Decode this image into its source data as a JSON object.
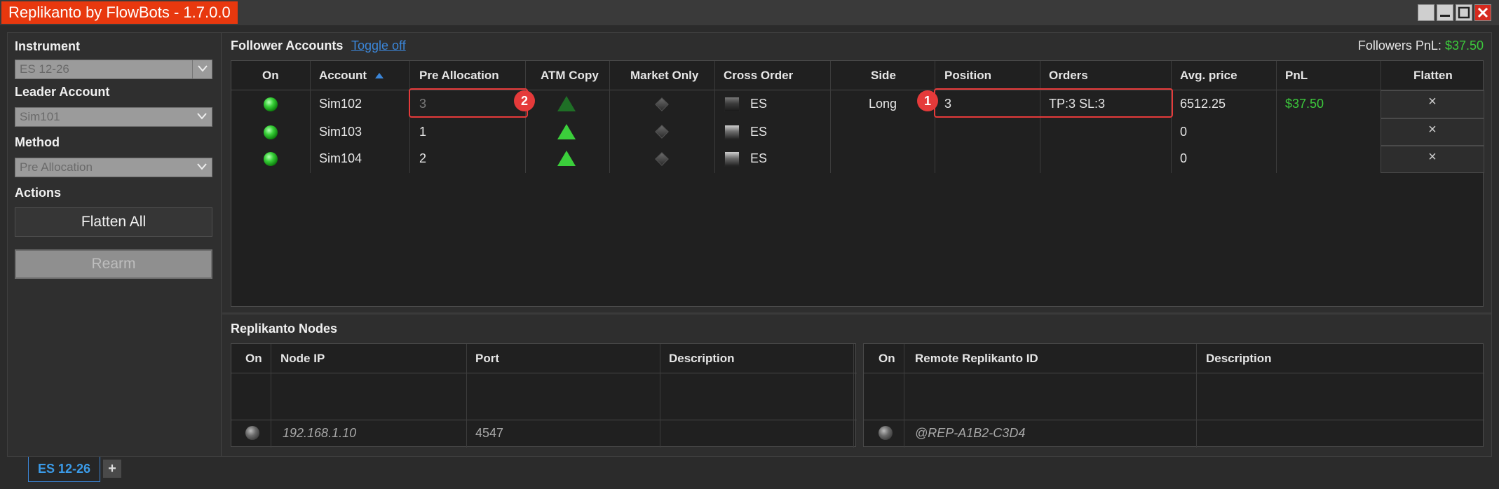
{
  "window": {
    "title": "Replikanto by FlowBots - 1.7.0.0"
  },
  "left_panel": {
    "instrument_label": "Instrument",
    "instrument_value": "ES 12-26",
    "leader_label": "Leader Account",
    "leader_value": "Sim101",
    "method_label": "Method",
    "method_value": "Pre Allocation",
    "actions_label": "Actions",
    "flatten_all_label": "Flatten All",
    "rearm_label": "Rearm"
  },
  "followers": {
    "section_title": "Follower Accounts",
    "toggle_label": "Toggle off",
    "pnl_label": "Followers PnL:",
    "pnl_value": "$37.50",
    "columns": [
      "On",
      "Account",
      "Pre Allocation",
      "ATM Copy",
      "Market Only",
      "Cross Order",
      "Side",
      "Position",
      "Orders",
      "Avg. price",
      "PnL",
      "Flatten"
    ],
    "rows": [
      {
        "on": true,
        "account": "Sim102",
        "pre_allocation": "3",
        "atm_copy": "dim",
        "cross_order": "ES",
        "side": "Long",
        "position": "3",
        "orders": "TP:3 SL:3",
        "avg_price": "6512.25",
        "pnl": "$37.50",
        "flatten": "×"
      },
      {
        "on": true,
        "account": "Sim103",
        "pre_allocation": "1",
        "atm_copy": "on",
        "cross_order": "ES",
        "side": "",
        "position": "",
        "orders": "",
        "avg_price": "0",
        "pnl": "",
        "flatten": "×"
      },
      {
        "on": true,
        "account": "Sim104",
        "pre_allocation": "2",
        "atm_copy": "on",
        "cross_order": "ES",
        "side": "",
        "position": "",
        "orders": "",
        "avg_price": "0",
        "pnl": "",
        "flatten": "×"
      }
    ],
    "pnl_color": "#3cc93c"
  },
  "callouts": {
    "badge_1": "1",
    "badge_2": "2",
    "color": "#e53a3a"
  },
  "nodes": {
    "section_title": "Replikanto Nodes",
    "left_columns": [
      "On",
      "Node IP",
      "Port",
      "Description"
    ],
    "left_row": {
      "node_ip": "192.168.1.10",
      "port": "4547",
      "description": ""
    },
    "right_columns": [
      "On",
      "Remote Replikanto ID",
      "Description"
    ],
    "right_row": {
      "remote_id": "@REP-A1B2-C3D4",
      "description": ""
    }
  },
  "tabs": {
    "active": "ES 12-26",
    "add": "+"
  },
  "colors": {
    "title_bg": "#e8380e",
    "accent_blue": "#3b86d8"
  }
}
